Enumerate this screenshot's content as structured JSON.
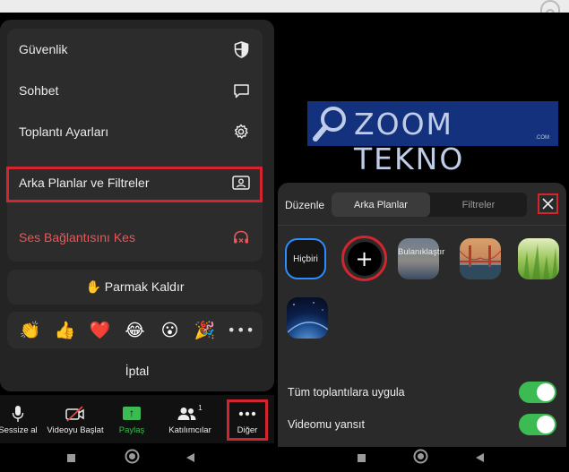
{
  "menu": {
    "items": [
      {
        "label": "Güvenlik",
        "icon": "shield-icon"
      },
      {
        "label": "Sohbet",
        "icon": "chat-bubble-icon"
      },
      {
        "label": "Toplantı Ayarları",
        "icon": "gear-icon"
      },
      {
        "label": "Arka Planlar ve Filtreler",
        "icon": "background-portrait-icon"
      },
      {
        "label": "Ses Bağlantısını Kes",
        "icon": "headphones-off-icon"
      }
    ],
    "raise_hand": "✋ Parmak Kaldır",
    "reactions": [
      "👏",
      "👍",
      "❤️",
      "😂",
      "😮",
      "🎉"
    ],
    "reactions_more": "•••",
    "cancel": "İptal"
  },
  "toolbar": {
    "mute": "Sessize al",
    "start_video": "Videoyu Başlat",
    "share": "Paylaş",
    "participants": "Katılımcılar",
    "participants_count": "1",
    "more": "Diğer"
  },
  "logo": {
    "text": "ZOOM TEKNO",
    "sub": ".COM"
  },
  "backgrounds": {
    "edit": "Düzenle",
    "tabs": [
      "Arka Planlar",
      "Filtreler"
    ],
    "active_tab": "Arka Planlar",
    "none_label": "Hiçbiri",
    "add_label": "+",
    "blur_label": "Bulanıklaştır",
    "apply_all": {
      "label": "Tüm toplantılara uygula",
      "on": true
    },
    "mirror": {
      "label": "Videomu yansıt",
      "on": true
    }
  },
  "colors": {
    "highlight": "#d3252e",
    "accent_green": "#3cbb52",
    "accent_blue": "#2d8cff",
    "danger": "#ec5656"
  }
}
